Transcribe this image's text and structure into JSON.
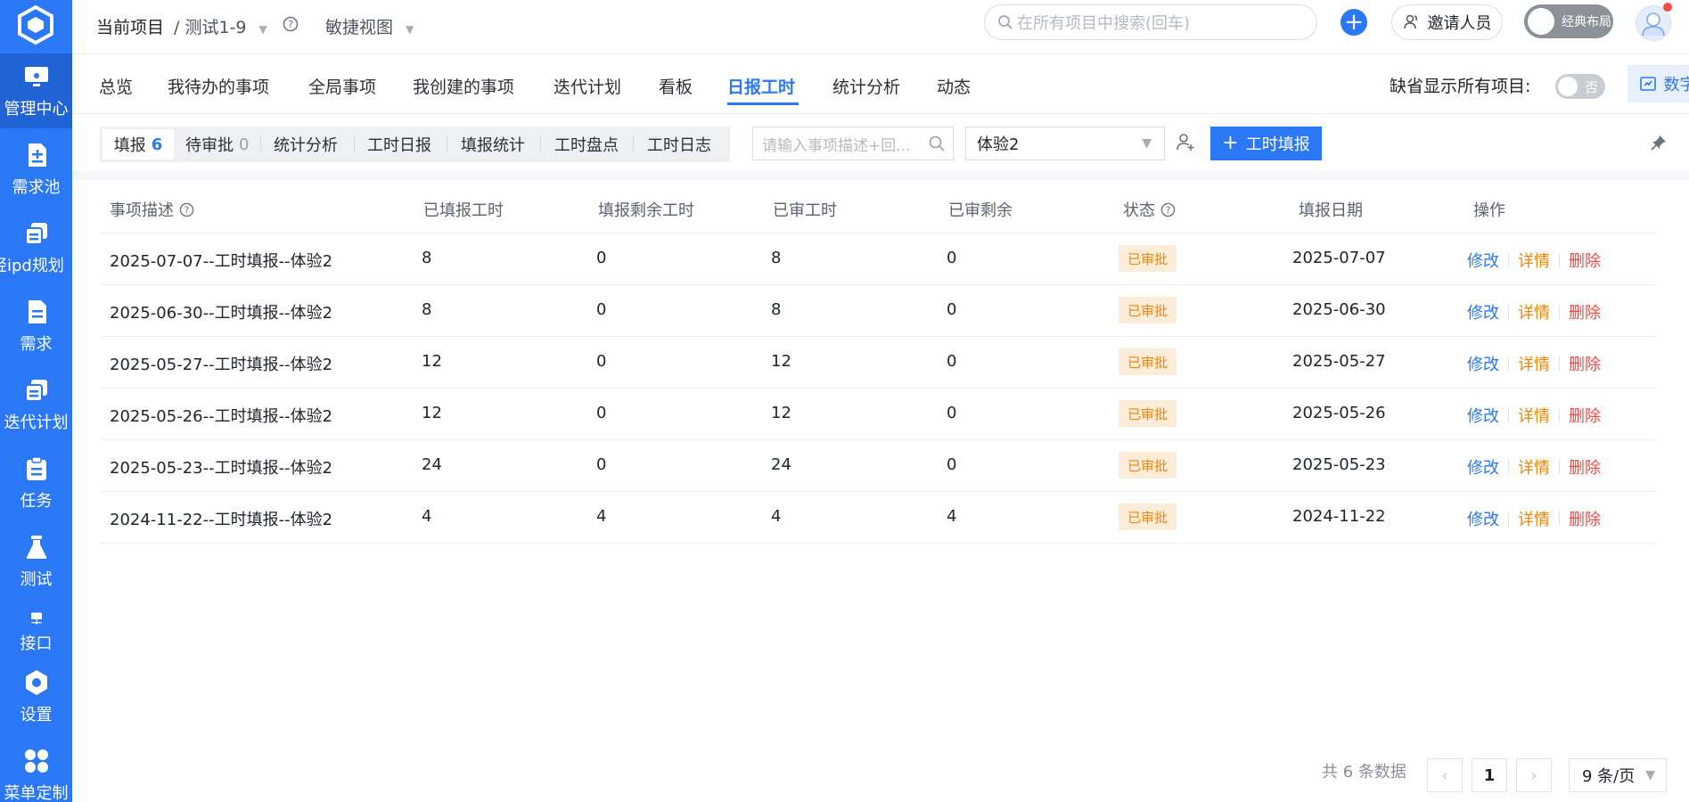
{
  "sidebar": {
    "items": [
      {
        "label": "管理中心",
        "icon": "monitor-icon",
        "active": true
      },
      {
        "label": "需求池",
        "icon": "requirement-pool-icon"
      },
      {
        "label": "轻ipd规划",
        "icon": "stack-icon"
      },
      {
        "label": "需求",
        "icon": "document-icon"
      },
      {
        "label": "迭代计划",
        "icon": "stack-icon"
      },
      {
        "label": "任务",
        "icon": "clipboard-icon"
      },
      {
        "label": "测试",
        "icon": "flask-icon"
      },
      {
        "label": "接口",
        "icon": "network-icon"
      },
      {
        "label": "设置",
        "icon": "gear-icon"
      },
      {
        "label": "菜单定制",
        "icon": "grid-icon"
      }
    ]
  },
  "topbar": {
    "current_project": "当前项目",
    "project_name": "/ 测试1-9",
    "agile_view": "敏捷视图",
    "search_placeholder": "在所有项目中搜索(回车)",
    "invite": "邀请人员",
    "layout": "经典布局"
  },
  "tabs": {
    "items": [
      "总览",
      "我待办的事项",
      "全局事项",
      "我创建的事项",
      "迭代计划",
      "看板",
      "日报工时",
      "统计分析",
      "动态"
    ],
    "active_index": 6,
    "default_all_label": "缺省显示所有项目:",
    "default_all_value": "否",
    "big_screen": "数字大屏"
  },
  "subbar": {
    "segments": [
      {
        "label": "填报",
        "count": "6",
        "active": true
      },
      {
        "label": "待审批",
        "count": "0"
      },
      {
        "label": "统计分析"
      },
      {
        "label": "工时日报"
      },
      {
        "label": "填报统计"
      },
      {
        "label": "工时盘点"
      },
      {
        "label": "工时日志"
      }
    ],
    "desc_placeholder": "请输入事项描述+回...",
    "user": "体验2",
    "fill_button": "工时填报"
  },
  "table": {
    "columns": [
      "事项描述",
      "已填报工时",
      "填报剩余工时",
      "已审工时",
      "已审剩余",
      "状态",
      "填报日期",
      "操作"
    ],
    "rows": [
      {
        "desc": "2025-07-07--工时填报--体验2",
        "reported": "8",
        "remaining": "0",
        "approved": "8",
        "approved_remaining": "0",
        "status": "已审批",
        "date": "2025-07-07"
      },
      {
        "desc": "2025-06-30--工时填报--体验2",
        "reported": "8",
        "remaining": "0",
        "approved": "8",
        "approved_remaining": "0",
        "status": "已审批",
        "date": "2025-06-30"
      },
      {
        "desc": "2025-05-27--工时填报--体验2",
        "reported": "12",
        "remaining": "0",
        "approved": "12",
        "approved_remaining": "0",
        "status": "已审批",
        "date": "2025-05-27"
      },
      {
        "desc": "2025-05-26--工时填报--体验2",
        "reported": "12",
        "remaining": "0",
        "approved": "12",
        "approved_remaining": "0",
        "status": "已审批",
        "date": "2025-05-26"
      },
      {
        "desc": "2025-05-23--工时填报--体验2",
        "reported": "24",
        "remaining": "0",
        "approved": "24",
        "approved_remaining": "0",
        "status": "已审批",
        "date": "2025-05-23"
      },
      {
        "desc": "2024-11-22--工时填报--体验2",
        "reported": "4",
        "remaining": "4",
        "approved": "4",
        "approved_remaining": "4",
        "status": "已审批",
        "date": "2024-11-22"
      }
    ],
    "actions": {
      "edit": "修改",
      "detail": "详情",
      "delete": "删除"
    }
  },
  "pagination": {
    "total_text": "共 6 条数据",
    "current_page": "1",
    "per_page": "9 条/页"
  },
  "colors": {
    "primary": "#2a78f5",
    "status_badge_bg": "#fdecd8",
    "status_badge_text": "#f0860a",
    "delete_red": "#f54a45"
  }
}
